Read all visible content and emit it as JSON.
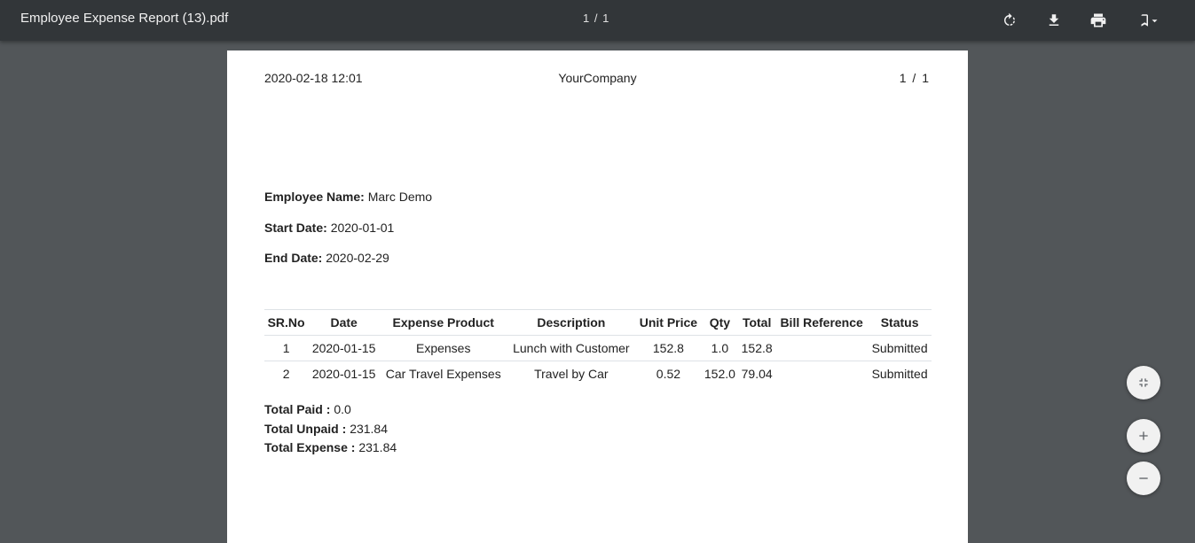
{
  "toolbar": {
    "title": "Employee Expense Report (13).pdf",
    "page_counter": "1 / 1",
    "icons": [
      "rotate-icon",
      "download-icon",
      "print-icon",
      "bookmark-icon"
    ]
  },
  "page": {
    "header_left": "2020-02-18 12:01",
    "header_center": "YourCompany",
    "header_right": "1 / 1",
    "employee_label": "Employee Name:",
    "employee_value": "Marc Demo",
    "start_label": "Start Date:",
    "start_value": "2020-01-01",
    "end_label": "End Date:",
    "end_value": "2020-02-29",
    "columns": [
      "SR.No",
      "Date",
      "Expense Product",
      "Description",
      "Unit Price",
      "Qty",
      "Total",
      "Bill Reference",
      "Status"
    ],
    "rows": [
      [
        "1",
        "2020-01-15",
        "Expenses",
        "Lunch with Customer",
        "152.8",
        "1.0",
        "152.8",
        "",
        "Submitted"
      ],
      [
        "2",
        "2020-01-15",
        "Car Travel Expenses",
        "Travel by Car",
        "0.52",
        "152.0",
        "79.04",
        "",
        "Submitted"
      ]
    ],
    "total_paid_label": "Total Paid :",
    "total_paid_value": "0.0",
    "total_unpaid_label": "Total Unpaid :",
    "total_unpaid_value": "231.84",
    "total_expense_label": "Total Expense :",
    "total_expense_value": "231.84"
  },
  "zoom": {
    "icons": [
      "fit-page-icon",
      "zoom-in-icon",
      "zoom-out-icon"
    ]
  }
}
